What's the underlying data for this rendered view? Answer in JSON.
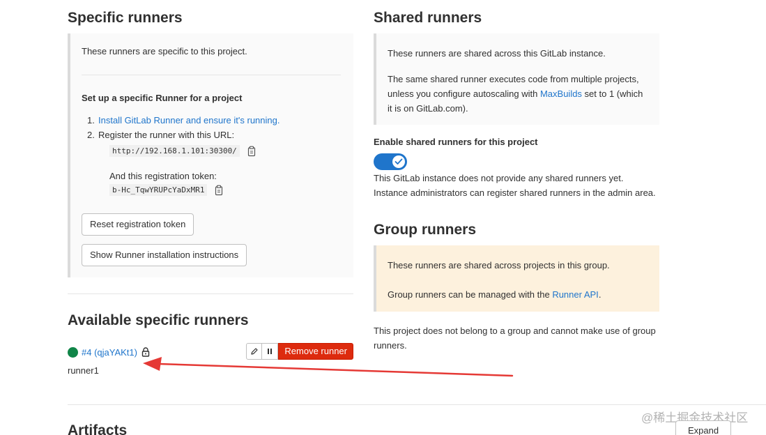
{
  "specific": {
    "title": "Specific runners",
    "intro": "These runners are specific to this project.",
    "setup_title": "Set up a specific Runner for a project",
    "step1_num": "1.",
    "step1_link": "Install GitLab Runner and ensure it's running.",
    "step2_num": "2.",
    "step2_text": "Register the runner with this URL:",
    "url": "http://192.168.1.101:30300/",
    "token_label": "And this registration token:",
    "token": "b-Hc_TqwYRUPcYaDxMR1",
    "reset_button": "Reset registration token",
    "show_button": "Show Runner installation instructions"
  },
  "available": {
    "title": "Available specific runners",
    "runner_id": "#4 (qjaYAKt1)",
    "runner_description": "runner1",
    "remove_button": "Remove runner",
    "status_color": "#108548"
  },
  "shared": {
    "title": "Shared runners",
    "p1": "These runners are shared across this GitLab instance.",
    "p2_before": "The same shared runner executes code from multiple projects, unless you configure autoscaling with ",
    "p2_link": "MaxBuilds",
    "p2_after": " set to 1 (which it is on GitLab.com).",
    "enable_label": "Enable shared runners for this project",
    "enabled": true,
    "no_shared": "This GitLab instance does not provide any shared runners yet. Instance administrators can register shared runners in the admin area."
  },
  "group": {
    "title": "Group runners",
    "p1": "These runners are shared across projects in this group.",
    "p2_before": "Group runners can be managed with the ",
    "p2_link": "Runner API",
    "p2_after": ".",
    "no_group": "This project does not belong to a group and cannot make use of group runners."
  },
  "artifacts": {
    "title": "Artifacts",
    "expand_button": "Expand"
  },
  "watermark": "@稀土掘金技术社区",
  "colors": {
    "link": "#1f75cb",
    "danger": "#dd2b0e",
    "toggle": "#1f75cb",
    "warning_bg": "#fdf1dd",
    "annotation_arrow": "#e53935"
  }
}
